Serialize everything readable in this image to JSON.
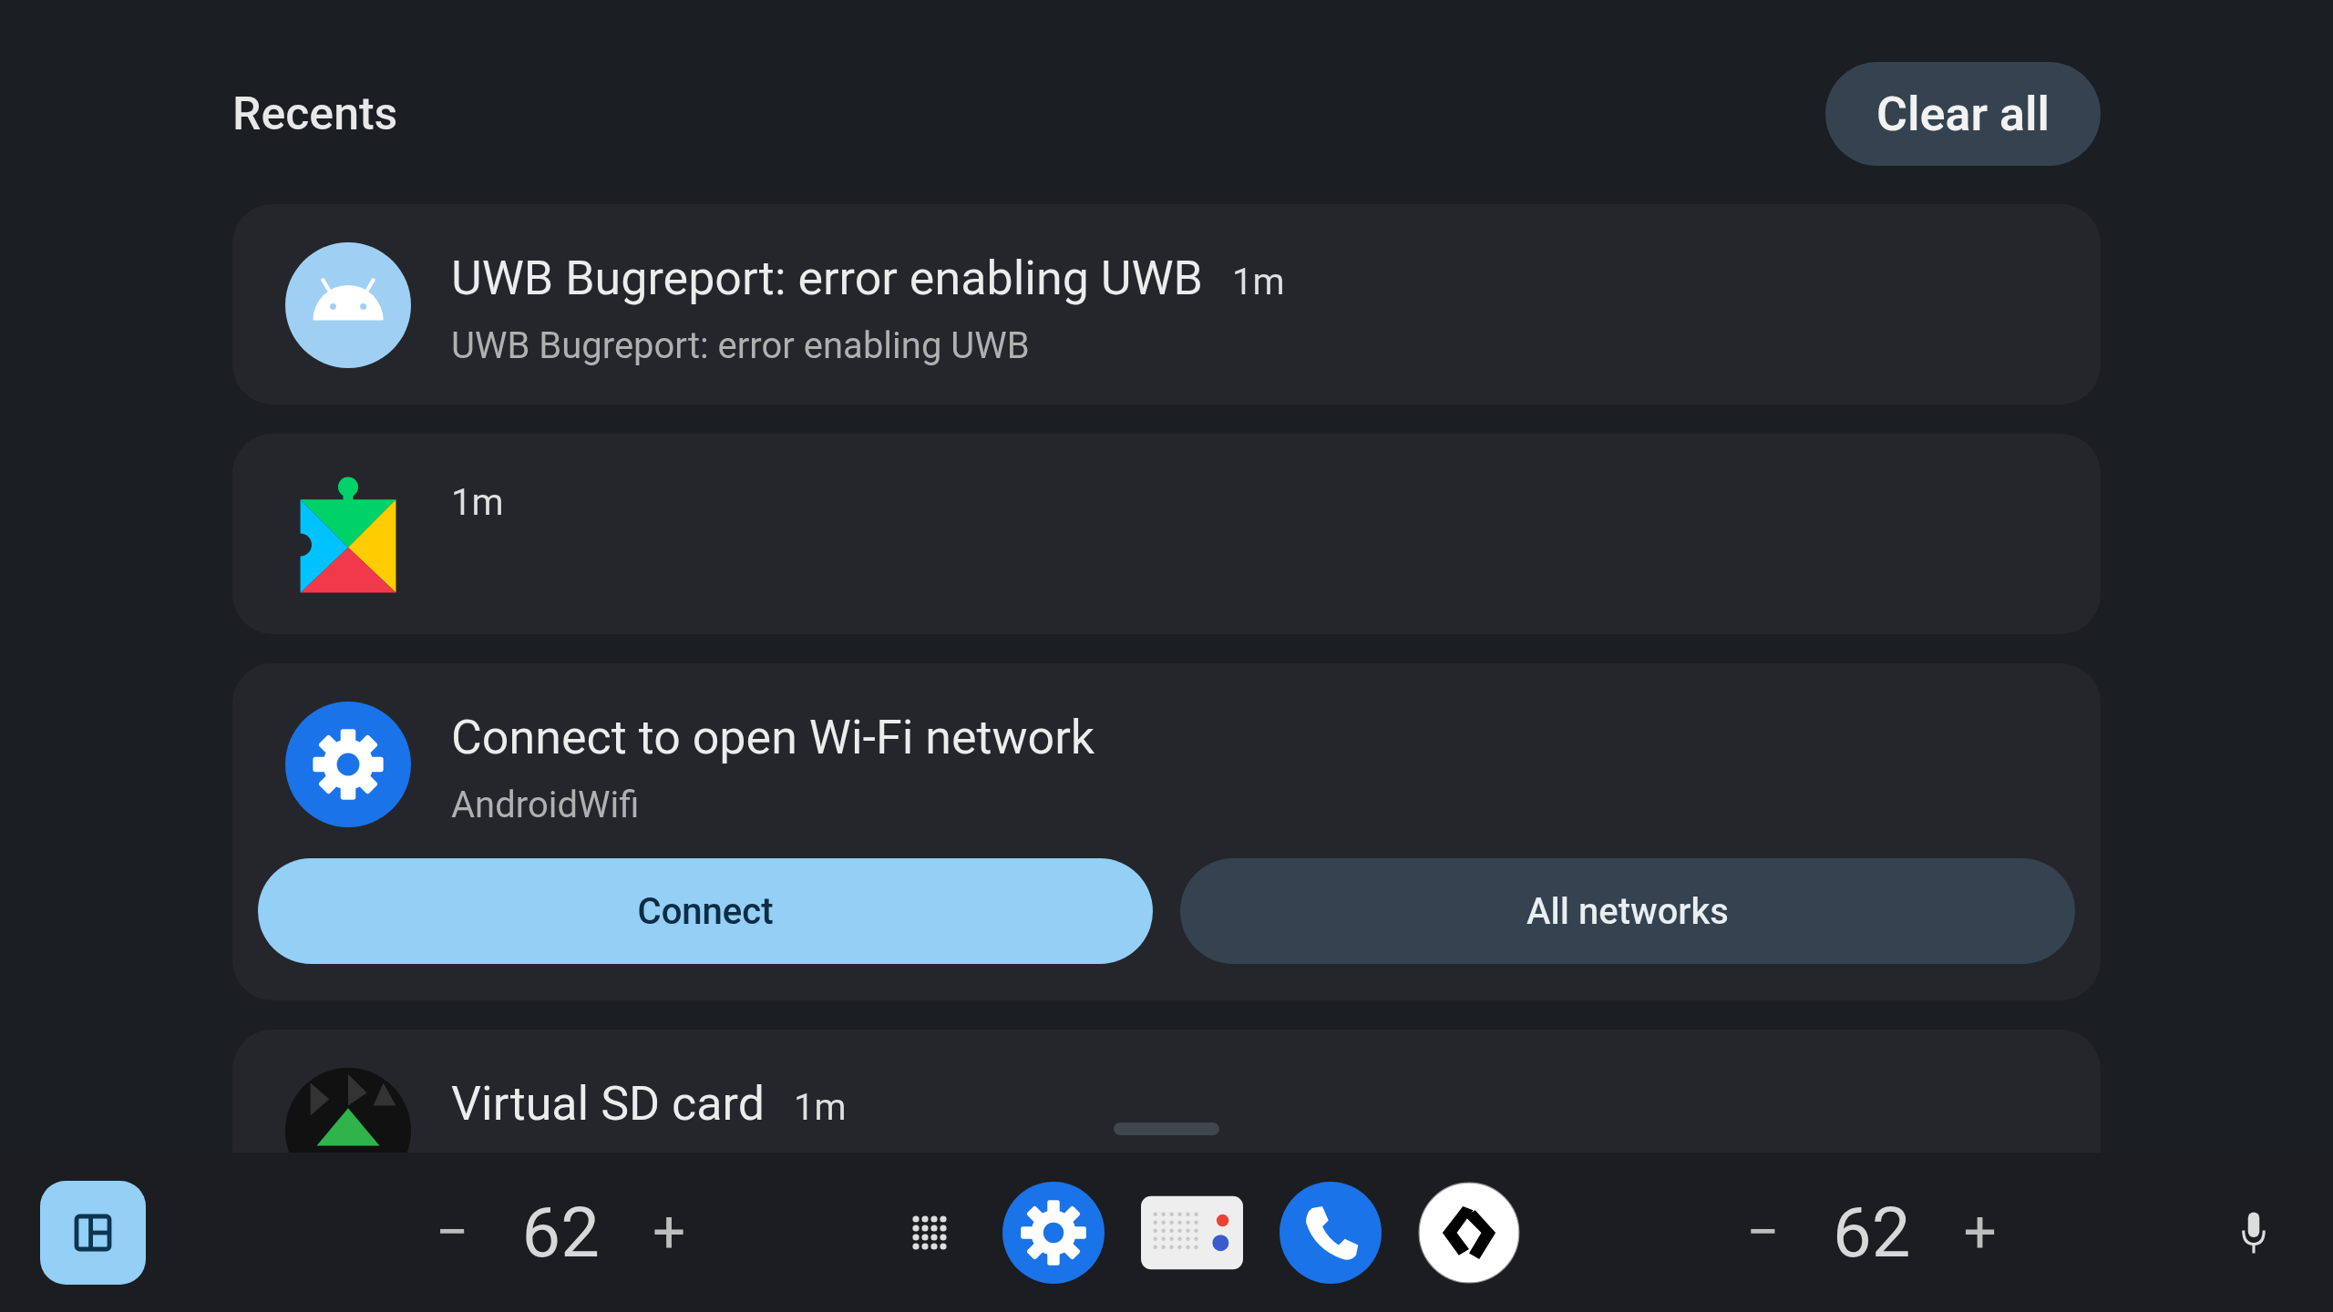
{
  "header": {
    "title": "Recents",
    "clear_button": "Clear all"
  },
  "notifications": [
    {
      "kind": "text",
      "title": "UWB Bugreport: error enabling UWB",
      "time": "1m",
      "body": "UWB Bugreport: error enabling UWB"
    },
    {
      "kind": "time_only",
      "time": "1m"
    },
    {
      "kind": "actions",
      "title": "Connect to open Wi-Fi network",
      "body": "AndroidWifi",
      "actions": [
        {
          "label": "Connect",
          "primary": true
        },
        {
          "label": "All networks",
          "primary": false
        }
      ]
    },
    {
      "kind": "text",
      "title": "Virtual SD card",
      "time": "1m"
    }
  ],
  "taskbar": {
    "left_volume": {
      "minus": "−",
      "value": "62",
      "plus": "+"
    },
    "right_volume": {
      "minus": "−",
      "value": "62",
      "plus": "+"
    }
  }
}
